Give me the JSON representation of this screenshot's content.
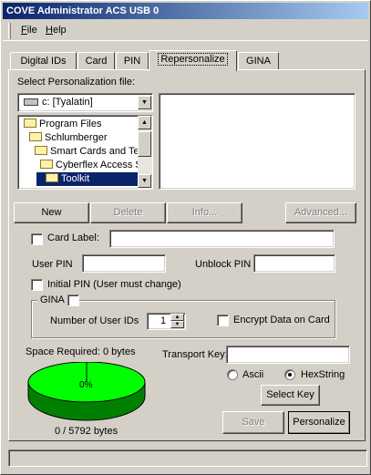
{
  "window": {
    "title": "COVE Administrator ACS USB 0"
  },
  "menu": {
    "file": "File",
    "help": "Help"
  },
  "tabs": [
    {
      "label": "Digital IDs"
    },
    {
      "label": "Card"
    },
    {
      "label": "PIN"
    },
    {
      "label": "Repersonalize"
    },
    {
      "label": "GINA"
    }
  ],
  "personalization": {
    "label": "Select Personalization file:",
    "drive": "c: [Tyalatin]",
    "tree": [
      "Program Files",
      "Schlumberger",
      "Smart Cards and Ter",
      "Cyberflex Access SD",
      "Toolkit"
    ],
    "selected_folder": "Toolkit"
  },
  "buttons": {
    "new": "New",
    "delete": "Delete",
    "info": "Info...",
    "advanced": "Advanced...",
    "select_key": "Select Key",
    "save": "Save",
    "personalize": "Personalize"
  },
  "fields": {
    "card_label": "Card Label:",
    "card_label_value": "",
    "user_pin": "User PIN",
    "user_pin_value": "",
    "unblock_pin": "Unblock PIN",
    "unblock_pin_value": "",
    "initial_pin": "Initial PIN (User must change)",
    "transport_key": "Transport Key:",
    "transport_key_value": ""
  },
  "gina": {
    "label": "GINA",
    "num_user_ids_label": "Number of User  IDs",
    "num_user_ids": "1",
    "encrypt": "Encrypt Data on Card"
  },
  "space": {
    "label": "Space Required: 0 bytes",
    "percent": "0%",
    "usage": "0 / 5792 bytes",
    "fraction": 0
  },
  "key_format": {
    "ascii": "Ascii",
    "hex": "HexString",
    "selected": "HexString"
  },
  "colors": {
    "titlebar": "#0a246a",
    "pie": "#00ff00",
    "selection": "#0a246a"
  }
}
